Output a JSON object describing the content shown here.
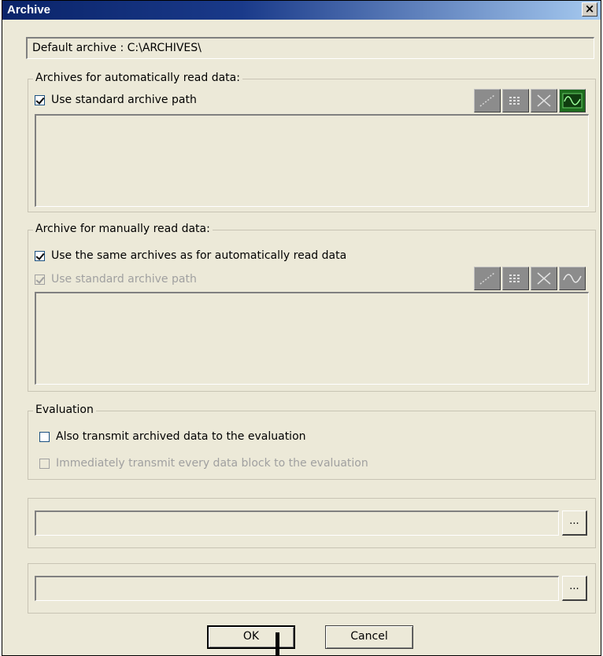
{
  "window": {
    "title": "Archive",
    "close_label": "×"
  },
  "default_archive": "Default archive : C:\\ARCHIVES\\",
  "auto_group": {
    "legend": "Archives for automatically read data:",
    "use_standard_path": {
      "label": "Use standard archive path",
      "checked": true
    },
    "icon_buttons": [
      "dotted-line-icon",
      "grid-data-icon",
      "cross-icon",
      "waveform-icon"
    ]
  },
  "manual_group": {
    "legend": "Archive for manually read data:",
    "use_same_archives": {
      "label": "Use the same archives as for automatically read data",
      "checked": true
    },
    "use_standard_path": {
      "label": "Use standard archive path",
      "checked": true,
      "disabled": true
    },
    "icon_buttons": [
      "dotted-line-icon",
      "grid-data-icon",
      "cross-icon",
      "waveform-icon"
    ]
  },
  "evaluation_group": {
    "legend": "Evaluation",
    "transmit_archived": {
      "label": "Also transmit archived data to the evaluation",
      "checked": false
    },
    "transmit_every_block": {
      "label": "Immediately transmit every data block to the evaluation",
      "checked": false,
      "disabled": true
    }
  },
  "path_field_1": {
    "value": "",
    "browse_label": "..."
  },
  "path_field_2": {
    "value": "",
    "browse_label": "..."
  },
  "buttons": {
    "ok": "OK",
    "cancel": "Cancel"
  }
}
